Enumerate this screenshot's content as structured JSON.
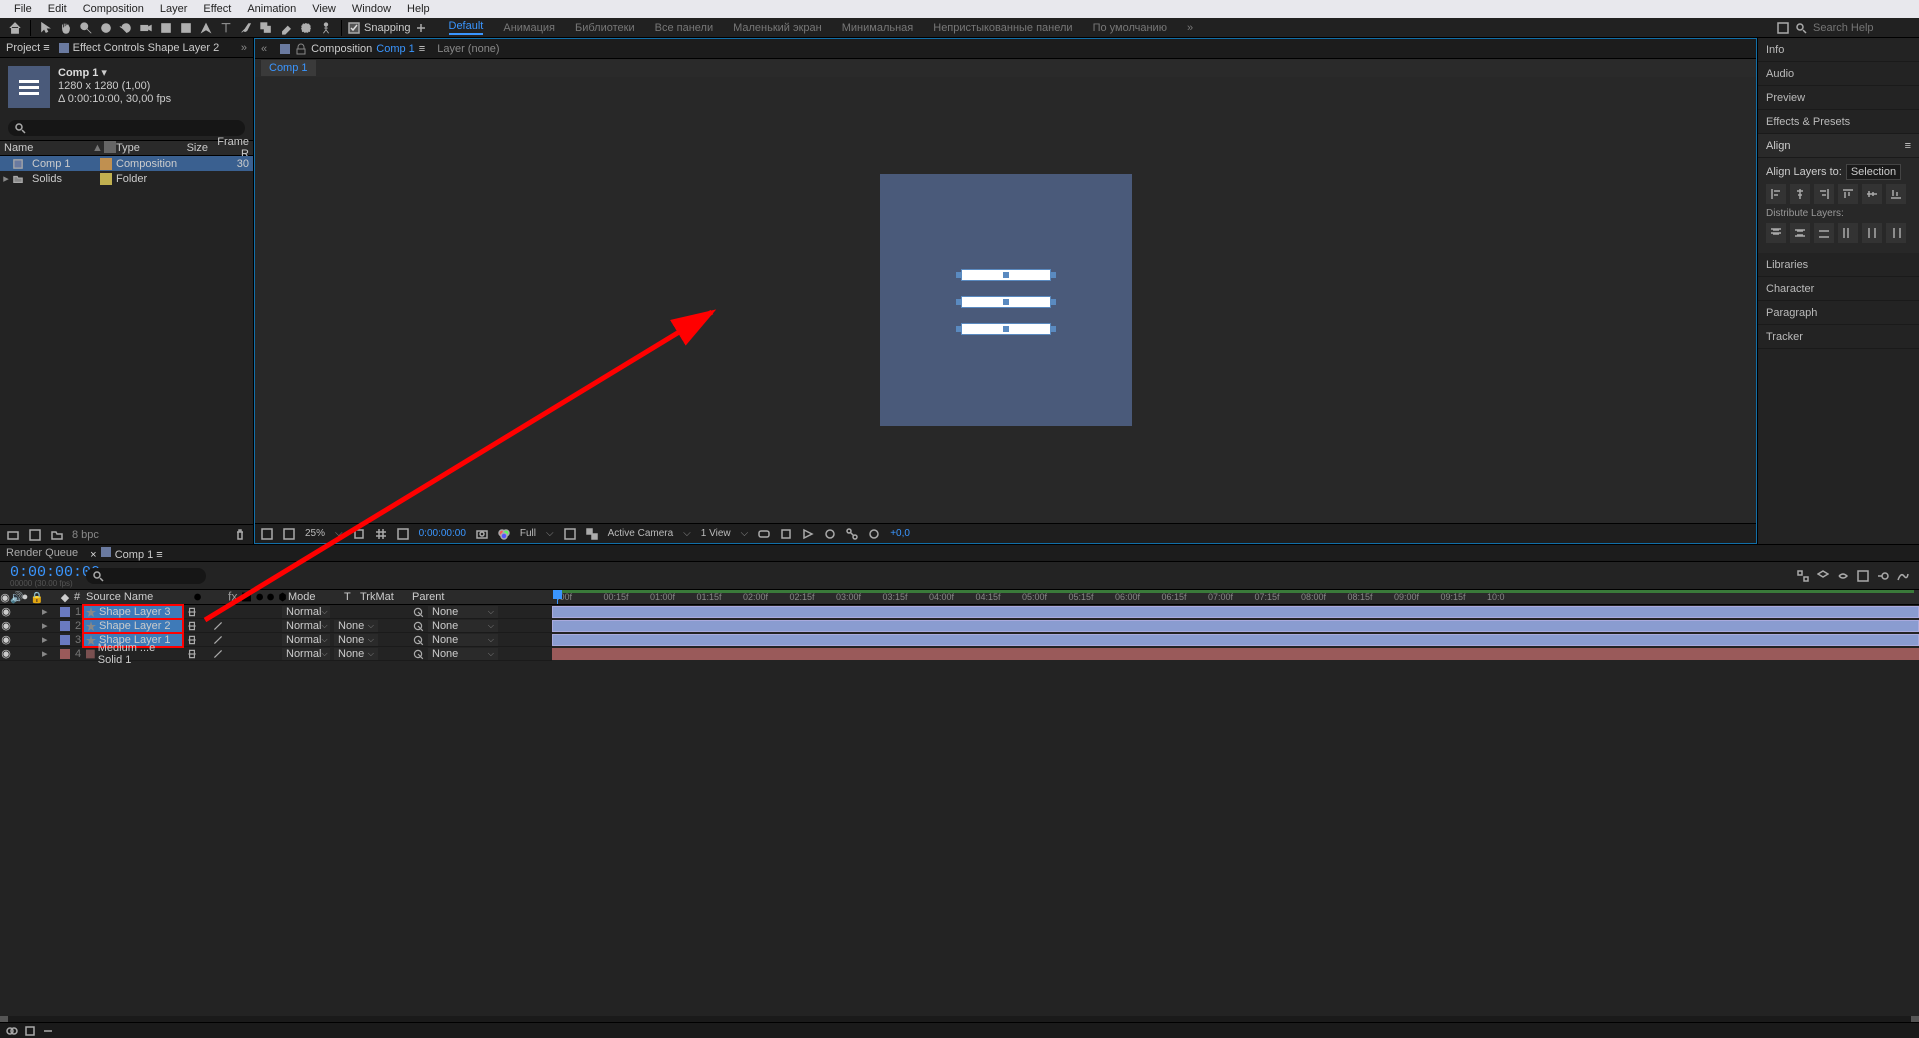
{
  "menu": {
    "items": [
      "File",
      "Edit",
      "Composition",
      "Layer",
      "Effect",
      "Animation",
      "View",
      "Window",
      "Help"
    ]
  },
  "toolbar": {
    "snapping": "Snapping",
    "workspaces_active": "Default",
    "workspaces": [
      "Анимация",
      "Библиотеки",
      "Все панели",
      "Маленький экран",
      "Минимальная",
      "Непристыкованные панели",
      "По умолчанию"
    ],
    "search_placeholder": "Search Help"
  },
  "project": {
    "tab_project": "Project",
    "tab_effect_controls": "Effect Controls Shape Layer 2",
    "comp_name": "Comp 1",
    "comp_dims": "1280 x 1280 (1,00)",
    "comp_dur": "Δ 0:00:10:00, 30,00 fps",
    "hdr_name": "Name",
    "hdr_type": "Type",
    "hdr_size": "Size",
    "hdr_frame": "Frame R",
    "items": [
      {
        "name": "Comp 1",
        "type": "Composition",
        "size": "",
        "frame": "30"
      },
      {
        "name": "Solids",
        "type": "Folder",
        "size": "",
        "frame": ""
      }
    ],
    "bpc": "8 bpc"
  },
  "viewer": {
    "tab_composition": "Composition",
    "comp_name": "Comp 1",
    "tab_layer": "Layer (none)",
    "zoom": "25%",
    "timecode": "0:00:00:00",
    "res": "Full",
    "camera": "Active Camera",
    "view": "1 View",
    "exposure": "+0,0"
  },
  "right": {
    "panels": [
      "Info",
      "Audio",
      "Preview",
      "Effects & Presets"
    ],
    "align_hdr": "Align",
    "align_to_label": "Align Layers to:",
    "align_to_value": "Selection",
    "distribute_label": "Distribute Layers:",
    "panels2": [
      "Libraries",
      "Character",
      "Paragraph",
      "Tracker"
    ]
  },
  "timeline": {
    "tab_render": "Render Queue",
    "tab_comp": "Comp 1",
    "timecode": "0:00:00:00",
    "timecode_sub": "00000 (30.00 fps)",
    "hdr_num": "#",
    "hdr_source": "Source Name",
    "hdr_mode": "Mode",
    "hdr_trkmat": "TrkMat",
    "hdr_parent": "Parent",
    "mode_normal": "Normal",
    "trkmat_none": "None",
    "parent_none": "None",
    "layers": [
      {
        "n": "1",
        "name": "Shape Layer 3",
        "kind": "shape",
        "selected": true
      },
      {
        "n": "2",
        "name": "Shape Layer 2",
        "kind": "shape",
        "selected": true
      },
      {
        "n": "3",
        "name": "Shape Layer 1",
        "kind": "shape",
        "selected": true
      },
      {
        "n": "4",
        "name": "Medium ...e Solid 1",
        "kind": "solid",
        "selected": false
      }
    ],
    "ticks": [
      ":00f",
      "00:15f",
      "01:00f",
      "01:15f",
      "02:00f",
      "02:15f",
      "03:00f",
      "03:15f",
      "04:00f",
      "04:15f",
      "05:00f",
      "05:15f",
      "06:00f",
      "06:15f",
      "07:00f",
      "07:15f",
      "08:00f",
      "08:15f",
      "09:00f",
      "09:15f",
      "10:0"
    ],
    "t_col": "T"
  }
}
